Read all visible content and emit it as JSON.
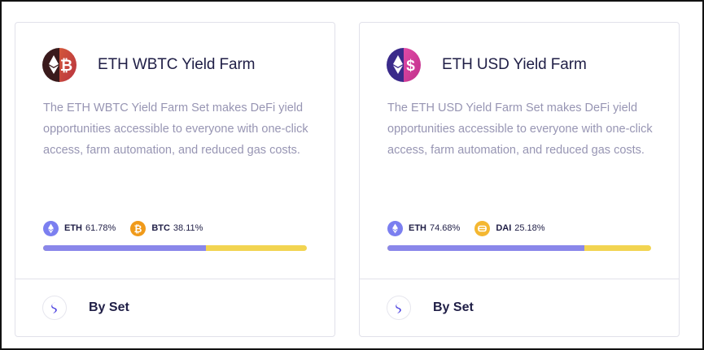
{
  "cards": [
    {
      "title": "ETH WBTC Yield Farm",
      "description": "The ETH WBTC Yield Farm Set makes DeFi yield opportunities accessible to everyone with one-click access, farm automation, and reduced gas costs.",
      "logo_icon": "eth-btc-logo-icon",
      "allocations": [
        {
          "symbol": "ETH",
          "percent": "61.78%",
          "icon": "eth-icon",
          "color": "#7b7ff0"
        },
        {
          "symbol": "BTC",
          "percent": "38.11%",
          "icon": "btc-icon",
          "color": "#f09a1a"
        }
      ],
      "allocation_fraction": 0.618,
      "footer_label": "By Set",
      "footer_icon": "set-logo-icon"
    },
    {
      "title": "ETH USD Yield Farm",
      "description": "The ETH USD Yield Farm Set makes DeFi yield opportunities accessible to everyone with one-click access, farm automation, and reduced gas costs.",
      "logo_icon": "eth-usd-logo-icon",
      "allocations": [
        {
          "symbol": "ETH",
          "percent": "74.68%",
          "icon": "eth-icon",
          "color": "#7b7ff0"
        },
        {
          "symbol": "DAI",
          "percent": "25.18%",
          "icon": "dai-icon",
          "color": "#f4b731"
        }
      ],
      "allocation_fraction": 0.748,
      "footer_label": "By Set",
      "footer_icon": "set-logo-icon"
    }
  ],
  "colors": {
    "title_text": "#1f1e46",
    "description_text": "#9795b3",
    "bar_primary": "#8a87ea",
    "bar_secondary": "#f2d451",
    "card_border": "#e1e1ea"
  }
}
